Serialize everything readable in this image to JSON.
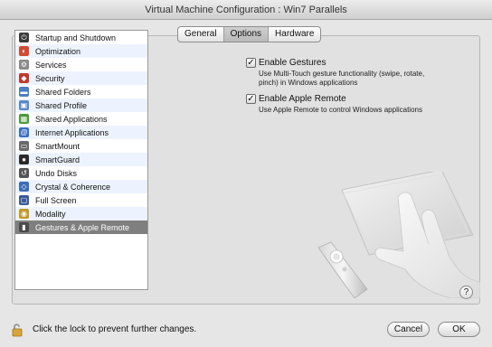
{
  "window": {
    "title": "Virtual Machine Configuration : Win7 Parallels"
  },
  "tabs": [
    {
      "label": "General",
      "active": false
    },
    {
      "label": "Options",
      "active": true
    },
    {
      "label": "Hardware",
      "active": false
    }
  ],
  "sidebar": {
    "items": [
      {
        "label": "Startup and Shutdown",
        "icon": "power-icon",
        "color": "#3a3a3a"
      },
      {
        "label": "Optimization",
        "icon": "optimization-icon",
        "color": "#d24a32"
      },
      {
        "label": "Services",
        "icon": "services-icon",
        "color": "#8a8a8a"
      },
      {
        "label": "Security",
        "icon": "security-icon",
        "color": "#c0392b"
      },
      {
        "label": "Shared Folders",
        "icon": "shared-folders-icon",
        "color": "#4a7fc1"
      },
      {
        "label": "Shared Profile",
        "icon": "shared-profile-icon",
        "color": "#5a86c8"
      },
      {
        "label": "Shared Applications",
        "icon": "shared-applications-icon",
        "color": "#4a9a3a"
      },
      {
        "label": "Internet Applications",
        "icon": "internet-applications-icon",
        "color": "#3a6fc0"
      },
      {
        "label": "SmartMount",
        "icon": "smartmount-icon",
        "color": "#6a6a6a"
      },
      {
        "label": "SmartGuard",
        "icon": "smartguard-icon",
        "color": "#2a2a2a"
      },
      {
        "label": "Undo Disks",
        "icon": "undo-disks-icon",
        "color": "#555555"
      },
      {
        "label": "Crystal & Coherence",
        "icon": "crystal-coherence-icon",
        "color": "#3b6db8"
      },
      {
        "label": "Full Screen",
        "icon": "full-screen-icon",
        "color": "#3a5a9a"
      },
      {
        "label": "Modality",
        "icon": "modality-icon",
        "color": "#c09a2a"
      },
      {
        "label": "Gestures & Apple Remote",
        "icon": "gestures-remote-icon",
        "color": "#4a4a4a"
      }
    ],
    "selected_index": 14
  },
  "options": {
    "gestures": {
      "label": "Enable Gestures",
      "checked": true,
      "description": "Use Multi-Touch gesture functionality (swipe, rotate, pinch) in Windows applications"
    },
    "remote": {
      "label": "Enable Apple Remote",
      "checked": true,
      "description": "Use Apple Remote to control Windows applications"
    }
  },
  "footer": {
    "lock_text": "Click the lock to prevent further changes.",
    "cancel_label": "Cancel",
    "ok_label": "OK",
    "help_label": "?"
  },
  "colors": {
    "selected_row": "#7f7f7f",
    "alternate_row": "#edf3fe"
  }
}
